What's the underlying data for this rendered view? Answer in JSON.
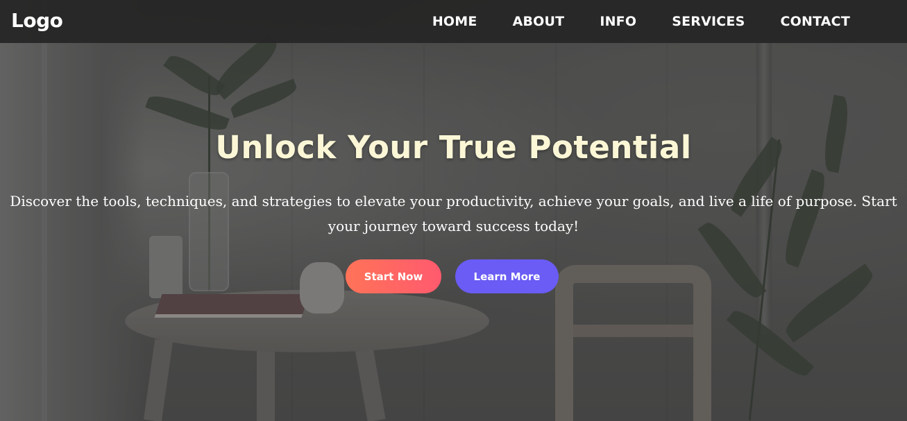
{
  "navbar": {
    "logo": "Logo",
    "links": [
      "HOME",
      "ABOUT",
      "INFO",
      "SERVICES",
      "CONTACT"
    ]
  },
  "hero": {
    "title": "Unlock Your True Potential",
    "description": "Discover the tools, techniques, and strategies to elevate your productivity, achieve your goals, and live a life of purpose. Start your journey toward success today!",
    "buttons": {
      "primary_label": "Start Now",
      "secondary_label": "Learn More"
    }
  },
  "colors": {
    "navbar_bg": "#262626",
    "title": "#fbf7d6",
    "primary_button_start": "#ff7358",
    "primary_button_end": "#ff5a6e",
    "secondary_button": "#6a5cf5"
  }
}
